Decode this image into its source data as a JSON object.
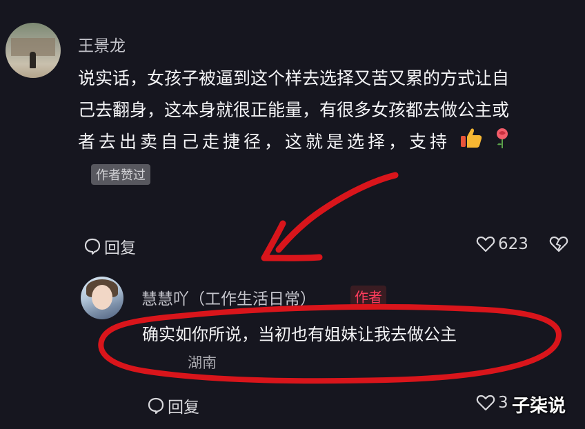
{
  "comments": [
    {
      "username": "王景龙",
      "lines": [
        "说实话，女孩子被逼到这个样去选择又苦又累的方式让自",
        "己去翻身，这本身就很正能量，有很多女孩都去做公主或",
        "者去出卖自己走捷径，这就是选择，支持"
      ],
      "liked_badge": "作者赞过",
      "reply_label": "回复",
      "likes": "623"
    }
  ],
  "reply": {
    "username": "慧慧吖（工作生活日常）",
    "author_badge": "作者",
    "text": "确实如你所说，当初也有姐妹让我去做公主",
    "location": "湖南",
    "reply_label": "回复",
    "likes": "3"
  },
  "watermark": "子柒说",
  "icons": [
    "thumbs-up-emoji",
    "rose-emoji",
    "reply-bubble-icon",
    "heart-icon",
    "broken-heart-icon"
  ],
  "colors": {
    "background": "#16161f",
    "author_badge": "#ff3d5d",
    "annotation": "#d9151b"
  }
}
